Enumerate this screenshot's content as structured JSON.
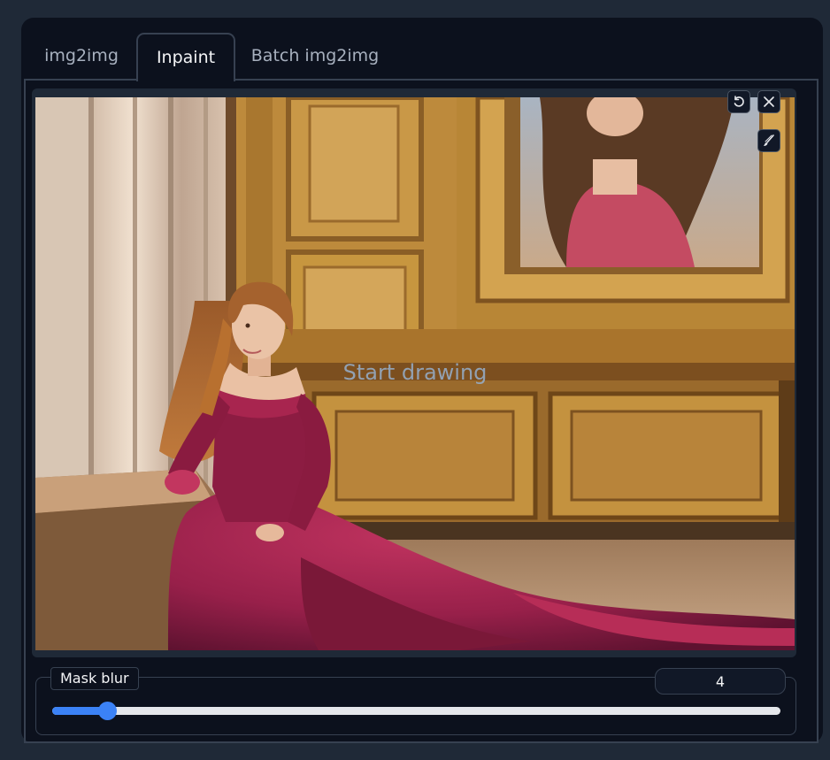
{
  "tabs": [
    {
      "label": "img2img",
      "active": false
    },
    {
      "label": "Inpaint",
      "active": true
    },
    {
      "label": "Batch img2img",
      "active": false
    }
  ],
  "canvas": {
    "overlay_text": "Start drawing",
    "image_subject": "woman in red gown seated by window in ornate gilded room",
    "tools": [
      "undo-icon",
      "close-icon",
      "brush-icon"
    ]
  },
  "mask_blur": {
    "label": "Mask blur",
    "value": "4",
    "min": 0,
    "max": 64,
    "fraction": 0.075
  },
  "colors": {
    "background": "#1f2937",
    "panel": "#0c111d",
    "border": "#374151",
    "accent": "#3b82f6",
    "dress": "#9b1f47",
    "gold": "#b9863c"
  }
}
